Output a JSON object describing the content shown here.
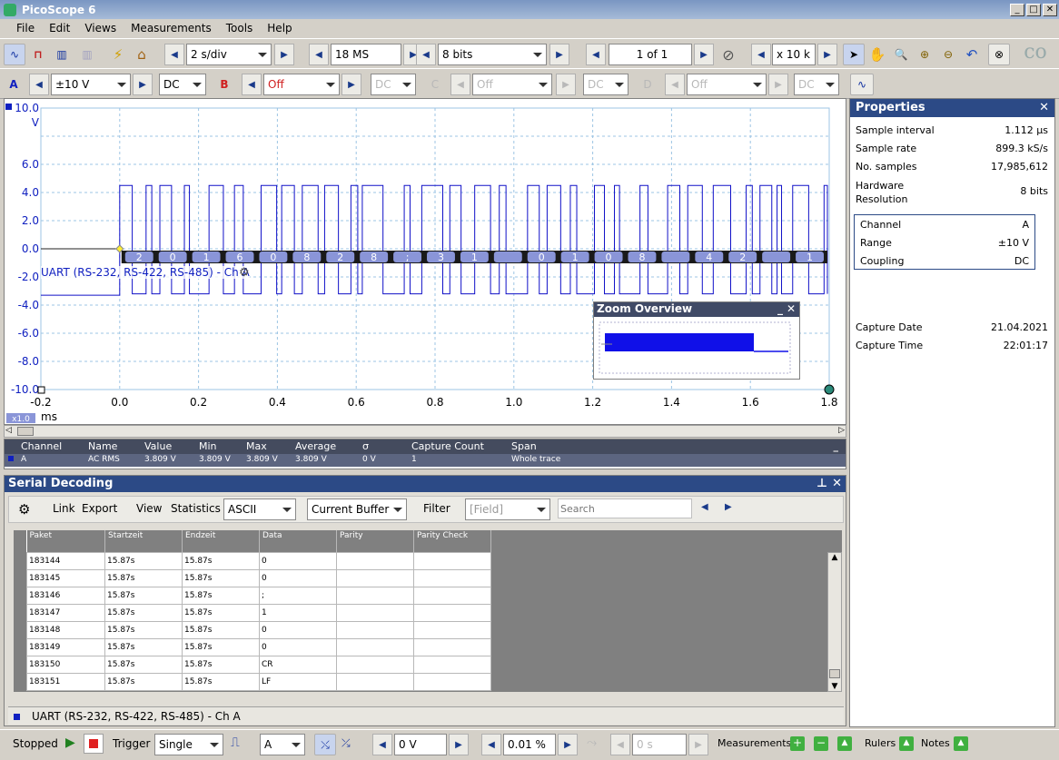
{
  "window": {
    "title": "PicoScope 6"
  },
  "menu": [
    "File",
    "Edit",
    "Views",
    "Measurements",
    "Tools",
    "Help"
  ],
  "toolbar1": {
    "timebase": "2 s/div",
    "samples": "18 MS",
    "resolution": "8 bits",
    "buffer": "1 of 1",
    "zoom": "x 10 k"
  },
  "toolbar2": {
    "chA": {
      "label": "A",
      "range": "±10 V",
      "coupling": "DC",
      "color": "#1020c0"
    },
    "chB": {
      "label": "B",
      "range": "Off",
      "coupling": "DC",
      "color": "#d02020"
    },
    "chC": {
      "label": "C",
      "range": "Off",
      "coupling": "DC"
    },
    "chD": {
      "label": "D",
      "range": "Off",
      "coupling": "DC"
    }
  },
  "scope": {
    "y_unit": "V",
    "y_ticks": [
      "10.0",
      "6.0",
      "4.0",
      "2.0",
      "0.0",
      "-2.0",
      "-4.0",
      "-6.0",
      "-8.0",
      "-10.0"
    ],
    "x_ticks": [
      "-0.2",
      "0.0",
      "0.2",
      "0.4",
      "0.6",
      "0.8",
      "1.0",
      "1.2",
      "1.4",
      "1.6",
      "1.8"
    ],
    "x_unit": "ms",
    "zoom_badge": "x1.0",
    "decoder_label": "UART (RS-232, RS-422, RS-485) - Ch A",
    "decoded_bytes": [
      "2",
      "0",
      "1",
      "6",
      "0",
      "8",
      "2",
      "8",
      ";",
      "3",
      "1",
      "",
      "0",
      "1",
      "0",
      "8",
      "",
      "4",
      "2",
      "",
      "1"
    ],
    "trace_color": "#1010c8",
    "decode_fill": "#8a95d8",
    "zoom_overview_title": "Zoom Overview"
  },
  "properties": {
    "title": "Properties",
    "rows": [
      {
        "k": "Sample interval",
        "v": "1.112 µs"
      },
      {
        "k": "Sample rate",
        "v": "899.3 kS/s"
      },
      {
        "k": "No. samples",
        "v": "17,985,612"
      },
      {
        "k": "Hardware Resolution",
        "v": "8 bits"
      }
    ],
    "channel": [
      {
        "k": "Channel",
        "v": "A"
      },
      {
        "k": "Range",
        "v": "±10 V"
      },
      {
        "k": "Coupling",
        "v": "DC"
      }
    ],
    "capture": [
      {
        "k": "Capture Date",
        "v": "21.04.2021"
      },
      {
        "k": "Capture Time",
        "v": "22:01:17"
      }
    ]
  },
  "measurements": {
    "headers": [
      "Channel",
      "Name",
      "Value",
      "Min",
      "Max",
      "Average",
      "σ",
      "Capture Count",
      "Span"
    ],
    "row": [
      "A",
      "AC RMS",
      "3.809 V",
      "3.809 V",
      "3.809 V",
      "3.809 V",
      "0 V",
      "1",
      "Whole trace"
    ]
  },
  "serial": {
    "title": "Serial Decoding",
    "link": "Link",
    "export": "Export",
    "view": "View",
    "statistics": "Statistics",
    "format": "ASCII",
    "buffer": "Current Buffer",
    "filter": "Filter",
    "field_placeholder": "[Field]",
    "search_placeholder": "Search",
    "columns": [
      "Paket",
      "Startzeit",
      "Endzeit",
      "Data",
      "Parity",
      "Parity Check"
    ],
    "rows": [
      [
        "183144",
        "15.87s",
        "15.87s",
        "0",
        "",
        ""
      ],
      [
        "183145",
        "15.87s",
        "15.87s",
        "0",
        "",
        ""
      ],
      [
        "183146",
        "15.87s",
        "15.87s",
        ";",
        "",
        ""
      ],
      [
        "183147",
        "15.87s",
        "15.87s",
        "1",
        "",
        ""
      ],
      [
        "183148",
        "15.87s",
        "15.87s",
        "0",
        "",
        ""
      ],
      [
        "183149",
        "15.87s",
        "15.87s",
        "0",
        "",
        ""
      ],
      [
        "183150",
        "15.87s",
        "15.87s",
        "CR",
        "",
        ""
      ],
      [
        "183151",
        "15.87s",
        "15.87s",
        "LF",
        "",
        ""
      ]
    ],
    "tab": "UART (RS-232, RS-422, RS-485) - Ch A"
  },
  "status": {
    "state": "Stopped",
    "trigger_label": "Trigger",
    "trigger_mode": "Single",
    "trigger_source": "A",
    "trigger_level": "0 V",
    "pretrigger": "0.01 %",
    "delay": "0 s",
    "measurements": "Measurements",
    "rulers": "Rulers",
    "notes": "Notes"
  }
}
